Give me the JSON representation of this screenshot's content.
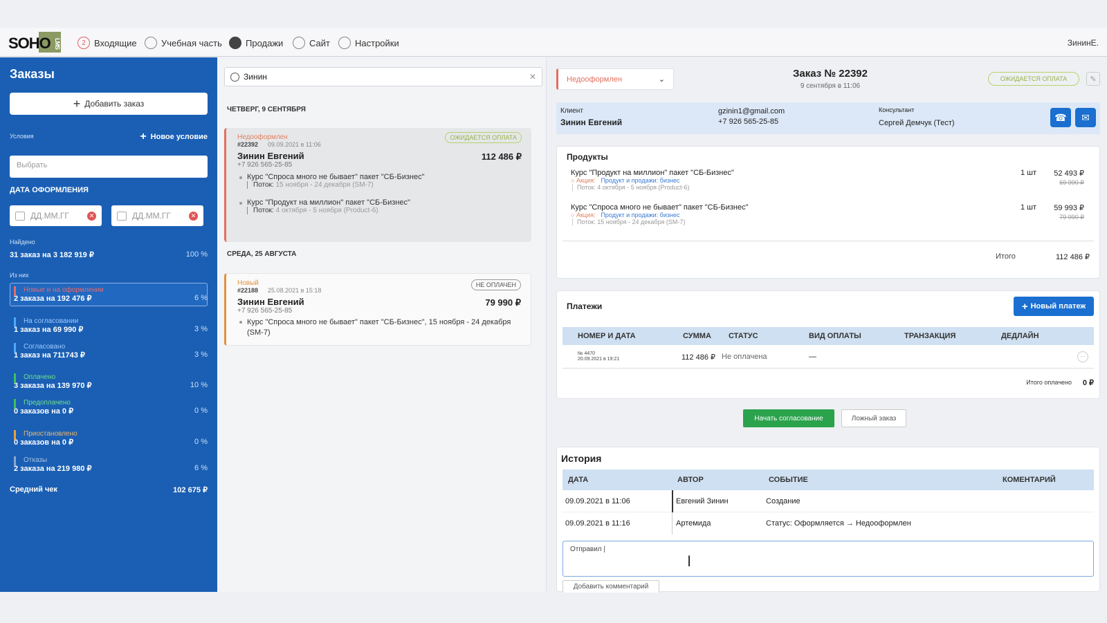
{
  "nav": {
    "logo_main": "SOHO",
    "logo_side": "LMS",
    "items": [
      {
        "label": "Входящие",
        "badge": "2"
      },
      {
        "label": "Учебная часть"
      },
      {
        "label": "Продажи"
      },
      {
        "label": "Сайт"
      },
      {
        "label": "Настройки"
      }
    ],
    "user": "ЗининЕ."
  },
  "sidebar": {
    "title": "Заказы",
    "add_order": "Добавить заказ",
    "conditions_label": "Условия",
    "new_condition": "Новое условие",
    "select_placeholder": "Выбрать",
    "date_heading": "ДАТА ОФОРМЛЕНИЯ",
    "date_from_placeholder": "ДД.ММ.ГГ",
    "date_to_placeholder": "ДД.ММ.ГГ",
    "found_label": "Найдено",
    "found_text": "31 заказ на 3 182 919 ₽",
    "found_pct": "100 %",
    "of_them_label": "Из них",
    "statuses": [
      {
        "label": "Новые и на оформлении",
        "value": "2 заказа на 192 476 ₽",
        "pct": "6 %",
        "color": "#e86a6a"
      },
      {
        "label": "На согласовании",
        "value": "1 заказ на 69 990 ₽",
        "pct": "3 %",
        "color": "#4fa8ff"
      },
      {
        "label": "Согласовано",
        "value": "1 заказ на 711743 ₽",
        "pct": "3 %",
        "color": "#4fa8ff"
      },
      {
        "label": "Оплачено",
        "value": "3 заказа на 139 970 ₽",
        "pct": "10 %",
        "color": "#3dc25a"
      },
      {
        "label": "Предоплачено",
        "value": "0 заказов на 0 ₽",
        "pct": "0 %",
        "color": "#3dc25a"
      },
      {
        "label": "Приостановлено",
        "value": "0 заказов на 0 ₽",
        "pct": "0 %",
        "color": "#e8a040"
      },
      {
        "label": "Отказы",
        "value": "2 заказа на 219 980 ₽",
        "pct": "6 %",
        "color": "#8aa8d0"
      }
    ],
    "avg_label": "Средний чек",
    "avg_value": "102 675 ₽"
  },
  "list": {
    "search_value": "Зинин",
    "day1": "ЧЕТВЕРГ, 9 СЕНТЯБРЯ",
    "day2": "СРЕДА, 25 АВГУСТА",
    "orders": [
      {
        "status": "Недооформлен",
        "number": "#22392",
        "datetime": "09.09.2021 в 11:06",
        "badge": "ОЖИДАЕТСЯ ОПЛАТА",
        "name": "Зинин Евгений",
        "phone": "+7 926 565-25-85",
        "amount": "112 486 ₽",
        "items": [
          {
            "title": "Курс \"Спроса много не бывает\" пакет \"СБ-Бизнес\"",
            "stream_label": "Поток:",
            "stream": "15 ноября - 24 декабря (SM-7)"
          },
          {
            "title": "Курс \"Продукт на миллион\" пакет \"СБ-Бизнес\"",
            "stream_label": "Поток:",
            "stream": "4 октября - 5 ноября (Product-6)"
          }
        ]
      },
      {
        "status": "Новый",
        "number": "#22188",
        "datetime": "25.08.2021 в 15:18",
        "badge": "НЕ ОПЛАЧЕН",
        "name": "Зинин Евгений",
        "phone": "+7 926 565-25-85",
        "amount": "79 990 ₽",
        "items": [
          {
            "title": "Курс \"Спроса много не бывает\" пакет \"СБ-Бизнес\", 15 ноября - 24 декабря (SM-7)"
          }
        ]
      }
    ]
  },
  "order": {
    "status_select": "Недооформлен",
    "title": "Заказ № 22392",
    "date": "9 сентября в 11:06",
    "badge": "ОЖИДАЕТСЯ ОПЛАТА",
    "client_label": "Клиент",
    "client_name": "Зинин Евгений",
    "email": "gzinin1@gmail.com",
    "phone": "+7 926 565-25-85",
    "consultant_label": "Консультант",
    "consultant": "Сергей Демчук (Тест)",
    "products_title": "Продукты",
    "products": [
      {
        "title": "Курс \"Продукт на миллион\" пакет \"СБ-Бизнес\"",
        "promo_label": "Акция:",
        "promo": "Продукт и продажи: бизнес",
        "stream": "Поток: 4 октября - 5 ноября (Product-6)",
        "qty": "1 шт",
        "price": "52 493 ₽",
        "old_price": "69 990 ₽"
      },
      {
        "title": "Курс \"Спроса много не бывает\" пакет \"СБ-Бизнес\"",
        "promo_label": "Акция:",
        "promo": "Продукт и продажи: бизнес",
        "stream": "Поток: 15 ноября - 24 декабря (SM-7)",
        "qty": "1 шт",
        "price": "59 993 ₽",
        "old_price": "79 990 ₽"
      }
    ],
    "total_label": "Итого",
    "total": "112 486 ₽",
    "payments_title": "Платежи",
    "new_payment": "Новый платеж",
    "pay_cols": [
      "НОМЕР И ДАТА",
      "СУММА",
      "СТАТУС",
      "ВИД ОПЛАТЫ",
      "ТРАНЗАКЦИЯ",
      "ДЕДЛАЙН"
    ],
    "payment": {
      "number": "№ 4470",
      "date": "20.09.2021 в 19:21",
      "sum": "112 486 ₽",
      "status": "Не оплачена",
      "type": "—"
    },
    "paid_label": "Итого оплачено",
    "paid_value": "0 ₽",
    "start_btn": "Начать согласование",
    "fake_btn": "Ложный заказ",
    "history_title": "История",
    "hist_cols": [
      "ДАТА",
      "АВТОР",
      "СОБЫТИЕ",
      "КОМЕНТАРИЙ"
    ],
    "history": [
      {
        "date": "09.09.2021 в 11:06",
        "author": "Евгений Зинин",
        "event": "Создание"
      },
      {
        "date": "09.09.2021 в 11:16",
        "author": "Артемида",
        "event": "Статус: Оформляется → Недооформлен"
      }
    ],
    "comment_value": "Отправил |",
    "add_comment": "Добавить комментарий"
  }
}
